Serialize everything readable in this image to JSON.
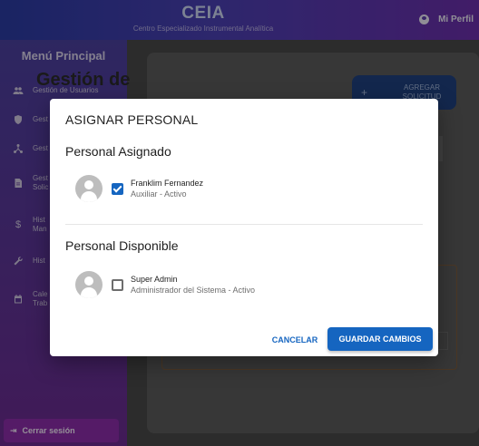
{
  "header": {
    "brand_title": "CEIA",
    "brand_subtitle": "Centro Especializado Instrumental Analítica",
    "profile_label": "Mi Perfil"
  },
  "sidebar": {
    "title": "Menú Principal",
    "items": [
      {
        "label": "Gestión de Usuarios",
        "icon": "users-icon"
      },
      {
        "label": "Gest",
        "icon": "shield-icon"
      },
      {
        "label": "Gest",
        "icon": "hub-icon"
      },
      {
        "label": "Gest\nSolic",
        "icon": "document-icon"
      },
      {
        "label": "Hist\nMan",
        "icon": "dollar-icon"
      },
      {
        "label": "Hist",
        "icon": "wrench-icon"
      },
      {
        "label": "Cale\nTrab",
        "icon": "calendar-icon"
      }
    ],
    "logout_label": "Cerrar sesión"
  },
  "main": {
    "title": "Gestión de",
    "add_button": "AGREGAR SOLICITUD"
  },
  "dialog": {
    "title": "ASIGNAR PERSONAL",
    "assigned_title": "Personal Asignado",
    "available_title": "Personal Disponible",
    "assigned": [
      {
        "name": "Franklim Fernandez",
        "role": "Auxiliar - Activo",
        "checked": true
      }
    ],
    "available": [
      {
        "name": "Super Admin",
        "role": "Administrador del Sistema - Activo",
        "checked": false
      }
    ],
    "cancel_label": "CANCELAR",
    "save_label": "GUARDAR CAMBIOS"
  }
}
